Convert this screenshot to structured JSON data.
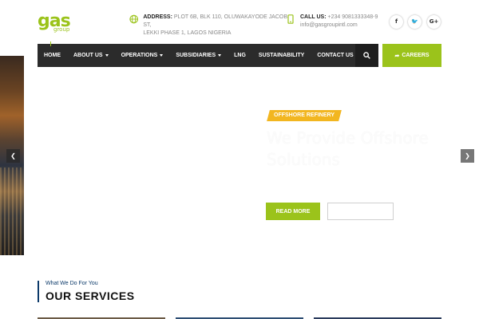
{
  "header": {
    "logo_text": "gas",
    "logo_sub": "group",
    "address_label": "ADDRESS:",
    "address_line1": "PLOT 6B, BLK 110, OLUWAKAYODE JACOB ST,",
    "address_line2": "LEKKI PHASE 1, LAGOS NIGERIA",
    "call_label": "CALL US:",
    "call_phone": "+234 9081333348-9",
    "call_email": "info@gasgroupintl.com",
    "social": [
      {
        "name": "facebook-icon",
        "glyph": "f"
      },
      {
        "name": "twitter-icon",
        "glyph": "🐦"
      },
      {
        "name": "google-plus-icon",
        "glyph": "G+"
      }
    ]
  },
  "nav": {
    "items": [
      {
        "label": "HOME",
        "dropdown": false
      },
      {
        "label": "ABOUT US",
        "dropdown": true
      },
      {
        "label": "OPERATIONS",
        "dropdown": true
      },
      {
        "label": "SUBSIDIARIES",
        "dropdown": true
      },
      {
        "label": "LNG",
        "dropdown": false
      },
      {
        "label": "SUSTAINABILITY",
        "dropdown": false
      },
      {
        "label": "CONTACT US",
        "dropdown": false
      }
    ],
    "search_icon": "search-icon",
    "careers_label": "CAREERS",
    "careers_icon": "share-icon"
  },
  "hero": {
    "tag": "OFFSHORE REFINERY",
    "headline": "We Provide Offshore Solutions",
    "read_more": "READ MORE"
  },
  "services": {
    "subtitle": "What We Do For You",
    "title": "OUR SERVICES"
  },
  "colors": {
    "accent": "#9bc31b",
    "nav_bg": "#2b2b2b",
    "tag": "#f2b620",
    "services_blue": "#0c3a6a"
  }
}
